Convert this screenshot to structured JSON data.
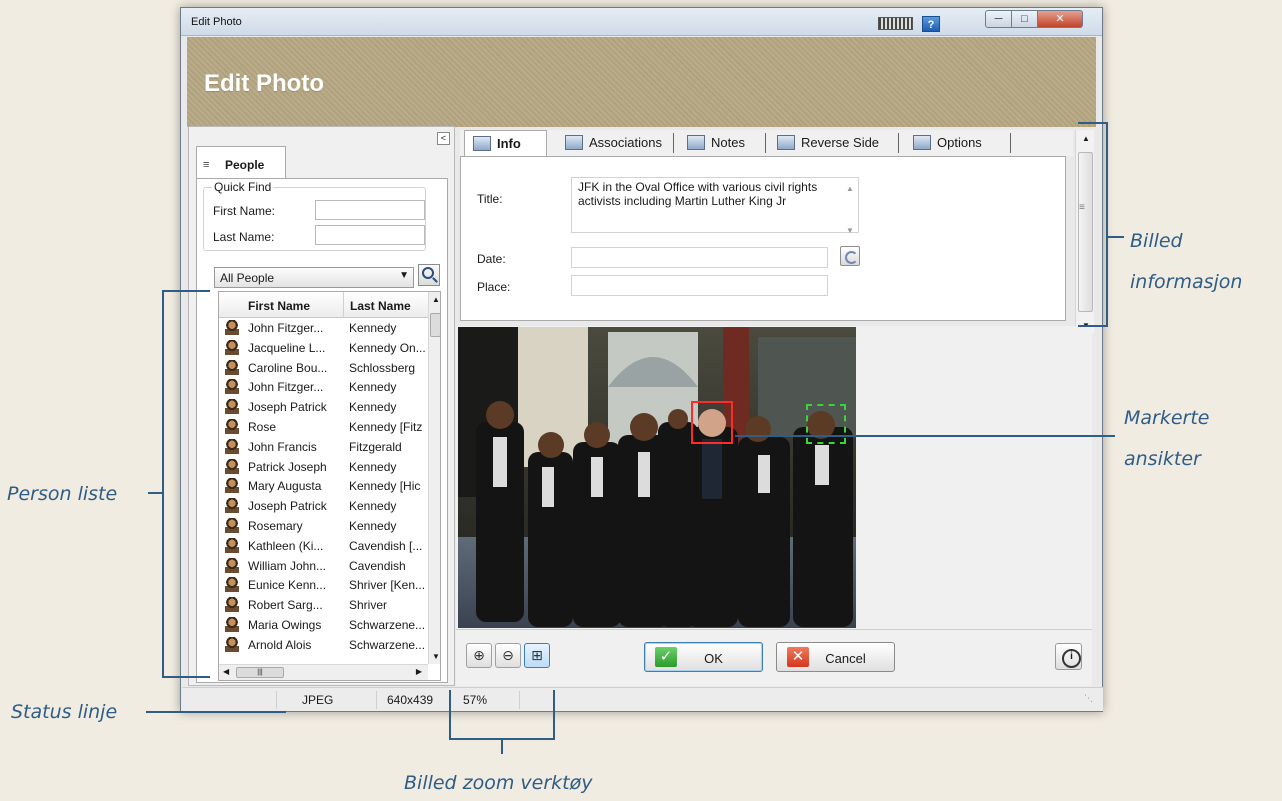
{
  "window": {
    "title": "Edit Photo",
    "banner_title": "Edit Photo"
  },
  "left_panel": {
    "collapse_glyph": "<",
    "tab_label": "People",
    "quick_find": {
      "legend": "Quick Find",
      "first_name_label": "First Name:",
      "last_name_label": "Last Name:",
      "first_name_value": "",
      "last_name_value": ""
    },
    "filter": {
      "selected": "All People"
    },
    "table": {
      "columns": [
        "First Name",
        "Last Name"
      ],
      "rows": [
        {
          "first": "John Fitzger...",
          "last": "Kennedy"
        },
        {
          "first": "Jacqueline L...",
          "last": "Kennedy On..."
        },
        {
          "first": "Caroline Bou...",
          "last": "Schlossberg"
        },
        {
          "first": "John Fitzger...",
          "last": "Kennedy"
        },
        {
          "first": "Joseph Patrick",
          "last": "Kennedy"
        },
        {
          "first": "Rose",
          "last": "Kennedy [Fitz"
        },
        {
          "first": "John Francis",
          "last": "Fitzgerald"
        },
        {
          "first": "Patrick Joseph",
          "last": "Kennedy"
        },
        {
          "first": "Mary Augusta",
          "last": "Kennedy [Hic"
        },
        {
          "first": "Joseph Patrick",
          "last": "Kennedy"
        },
        {
          "first": "Rosemary",
          "last": "Kennedy"
        },
        {
          "first": "Kathleen (Ki...",
          "last": "Cavendish [..."
        },
        {
          "first": "William John...",
          "last": "Cavendish"
        },
        {
          "first": "Eunice Kenn...",
          "last": "Shriver [Ken..."
        },
        {
          "first": "Robert Sarg...",
          "last": "Shriver"
        },
        {
          "first": "Maria Owings",
          "last": "Schwarzene..."
        },
        {
          "first": "Arnold Alois",
          "last": "Schwarzene..."
        }
      ]
    }
  },
  "tabs": [
    {
      "label": "Info",
      "icon": "info-card-icon"
    },
    {
      "label": "Associations",
      "icon": "associations-icon"
    },
    {
      "label": "Notes",
      "icon": "notes-icon"
    },
    {
      "label": "Reverse Side",
      "icon": "reverse-side-icon"
    },
    {
      "label": "Options",
      "icon": "options-icon"
    }
  ],
  "info": {
    "title_label": "Title:",
    "title_value": "JFK in the Oval Office with various civil rights activists including Martin Luther King Jr",
    "date_label": "Date:",
    "date_value": "",
    "place_label": "Place:",
    "place_value": ""
  },
  "toolbar": {
    "ok_label": "OK",
    "cancel_label": "Cancel"
  },
  "status": {
    "format": "JPEG",
    "dimensions": "640x439",
    "zoom": "57%"
  },
  "annotations": {
    "billed_info_1": "Billed",
    "billed_info_2": "informasjon",
    "markerte_1": "Markerte",
    "markerte_2": "ansikter",
    "person_liste": "Person liste",
    "status_linje": "Status linje",
    "zoom_verktoy": "Billed zoom verktøy"
  },
  "colors": {
    "annotation": "#2f5d86",
    "banner": "#b7a883",
    "face_marker_selected": "#ff2a2a",
    "face_marker_other": "#3bd43b"
  }
}
